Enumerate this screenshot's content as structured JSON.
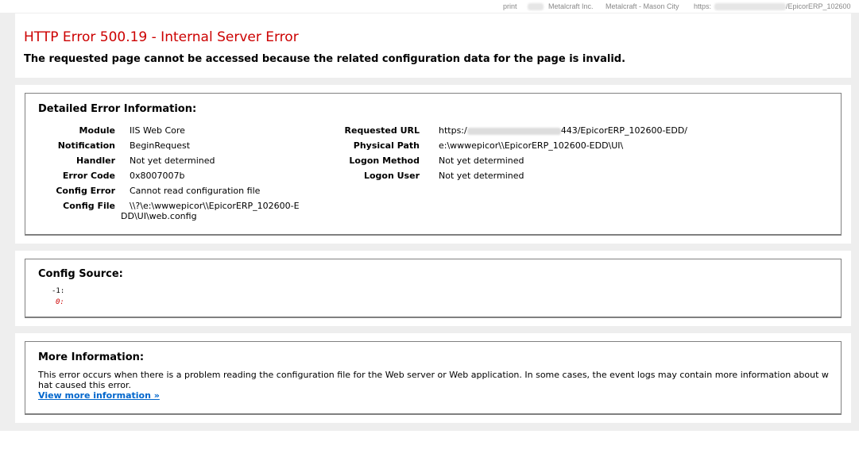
{
  "topbar": {
    "print": "print",
    "company": "Metalcraft Inc.",
    "site": "Metalcraft - Mason City",
    "url_prefix": "https:",
    "url_suffix": "/EpicorERP_102600"
  },
  "header": {
    "title": "HTTP Error 500.19 - Internal Server Error",
    "subtitle": "The requested page cannot be accessed because the related configuration data for the page is invalid."
  },
  "detail": {
    "heading": "Detailed Error Information:",
    "left": [
      {
        "label": "Module",
        "value": "IIS Web Core"
      },
      {
        "label": "Notification",
        "value": "BeginRequest"
      },
      {
        "label": "Handler",
        "value": "Not yet determined"
      },
      {
        "label": "Error Code",
        "value": "0x8007007b"
      },
      {
        "label": "Config Error",
        "value": "Cannot read configuration file"
      },
      {
        "label": "Config File",
        "value_line1": "\\\\?\\e:\\wwwepicor\\\\EpicorERP_102600-E",
        "value_line2": "DD\\UI\\web.config"
      }
    ],
    "right": [
      {
        "label": "Requested URL",
        "value_prefix": "https:/",
        "value_suffix": "443/EpicorERP_102600-EDD/"
      },
      {
        "label": "Physical Path",
        "value": "e:\\wwwepicor\\\\EpicorERP_102600-EDD\\UI\\"
      },
      {
        "label": "Logon Method",
        "value": "Not yet determined"
      },
      {
        "label": "Logon User",
        "value": "Not yet determined"
      }
    ]
  },
  "config_source": {
    "heading": "Config Source:",
    "line1": "-1:",
    "line2": "0:"
  },
  "more_info": {
    "heading": "More Information:",
    "text": "This error occurs when there is a problem reading the configuration file for the Web server or Web application. In some cases, the event logs may contain more information about what caused this error.",
    "link": "View more information »"
  },
  "colors": {
    "error_title": "#cc0000",
    "link": "#0066cc",
    "page_background": "#eeeeee",
    "code_line_red": "#cc0000"
  }
}
